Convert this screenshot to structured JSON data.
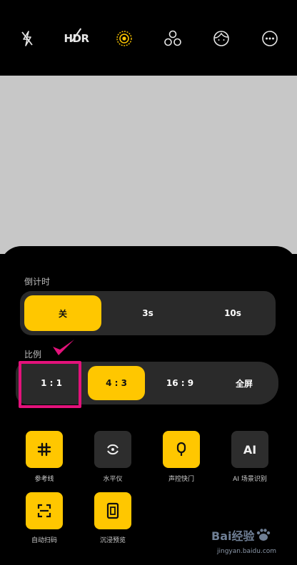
{
  "top_bar": {
    "icons": [
      "flash-off-icon",
      "hdr-off-icon",
      "live-photo-icon",
      "filter-icon",
      "beauty-face-icon",
      "more-icon"
    ],
    "hdr_label": "HDR",
    "accent": "#ffc700"
  },
  "timer": {
    "label": "倒计时",
    "options": [
      "关",
      "3s",
      "10s"
    ],
    "selected": "关"
  },
  "ratio": {
    "label": "比例",
    "options": [
      "1:1",
      "4:3",
      "16:9",
      "全屏"
    ],
    "display": [
      "1 : 1",
      "4 : 3",
      "16 : 9",
      "全屏"
    ],
    "selected": "4:3",
    "highlight_color": "#e3127b"
  },
  "tools": [
    {
      "label": "参考线",
      "icon": "grid-hash-icon",
      "on": true
    },
    {
      "label": "水平仪",
      "icon": "level-icon",
      "on": false
    },
    {
      "label": "声控快门",
      "icon": "voice-shutter-icon",
      "on": true
    },
    {
      "label": "AI 场景识别",
      "icon": "ai-scene-icon",
      "on": false,
      "icon_text": "AI"
    },
    {
      "label": "自动扫码",
      "icon": "scan-code-icon",
      "on": true
    },
    {
      "label": "沉浸预览",
      "icon": "immersive-preview-icon",
      "on": true
    }
  ],
  "watermark": {
    "brand": "Bai经验",
    "url": "jingyan.baidu.com"
  }
}
